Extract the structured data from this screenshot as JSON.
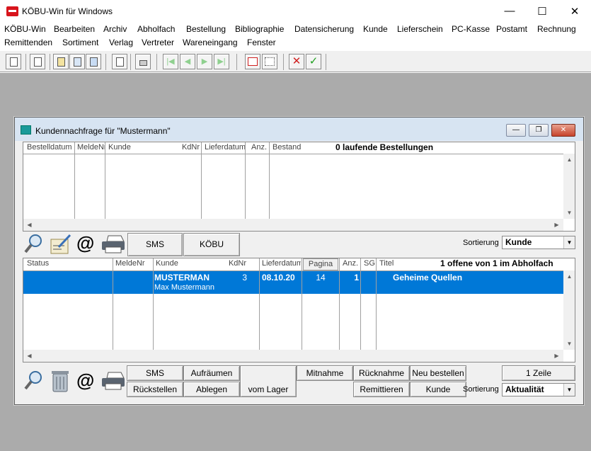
{
  "window": {
    "title": "KÖBU-Win für Windows",
    "minimize": "—",
    "maximize": "☐",
    "close": "✕"
  },
  "menu": [
    "KÖBU-Win",
    "Bearbeiten",
    "Archiv",
    "Abholfach",
    "Bestellung",
    "Bibliographie",
    "Datensicherung",
    "Kunde",
    "Lieferschein",
    "PC-Kasse",
    "Postamt",
    "Rechnung",
    "Remittenden",
    "Sortiment",
    "Verlag",
    "Vertreter",
    "Wareneingang",
    "Fenster"
  ],
  "toolbar": {
    "cancel": "✕",
    "ok": "✓",
    "nav_first": "|◀",
    "nav_prev": "◀",
    "nav_next": "▶",
    "nav_last": "▶|"
  },
  "child": {
    "title": "Kundennachfrage für \"Mustermann\"",
    "controls": {
      "minimize": "—",
      "restore": "❐",
      "close": "✕"
    }
  },
  "orders": {
    "columns": [
      "Bestelldatum",
      "MeldeNr",
      "Kunde",
      "KdNr",
      "Lieferdatum",
      "Anz.",
      "Bestand"
    ],
    "summary": "0 laufende Bestellungen",
    "buttons": {
      "sms": "SMS",
      "koebu": "KÖBU"
    },
    "sort_label": "Sortierung",
    "sort_value": "Kunde"
  },
  "pickup": {
    "columns": [
      "Status",
      "MeldeNr",
      "Kunde",
      "KdNr",
      "Lieferdatum",
      "Pagina",
      "Anz.",
      "SG",
      "Titel"
    ],
    "summary": "1 offene von 1 im Abholfach",
    "rows": [
      {
        "status": "",
        "meldenr": "",
        "kunde": "MUSTERMAN",
        "kunde_name": "Max Mustermann",
        "kdnr": "3",
        "lieferdatum": "08.10.20",
        "pagina": "14",
        "anz": "1",
        "sg": "",
        "titel": "Geheime Quellen"
      }
    ]
  },
  "bottom": {
    "sms": "SMS",
    "aufraeumen": "Aufräumen",
    "mitnahme": "Mitnahme",
    "ruecknahme": "Rücknahme",
    "neu_bestellen": "Neu bestellen",
    "eine_zeile": "1 Zeile",
    "rueckstellen": "Rückstellen",
    "ablegen": "Ablegen",
    "vom_lager": "vom Lager",
    "remittieren": "Remittieren",
    "kunde": "Kunde",
    "sort_label": "Sortierung",
    "sort_value": "Aktualität"
  },
  "icons": {
    "at": "@",
    "scroll_up": "▲",
    "scroll_down": "▼",
    "scroll_left": "◀",
    "scroll_right": "▶",
    "combo_arrow": "▼"
  }
}
